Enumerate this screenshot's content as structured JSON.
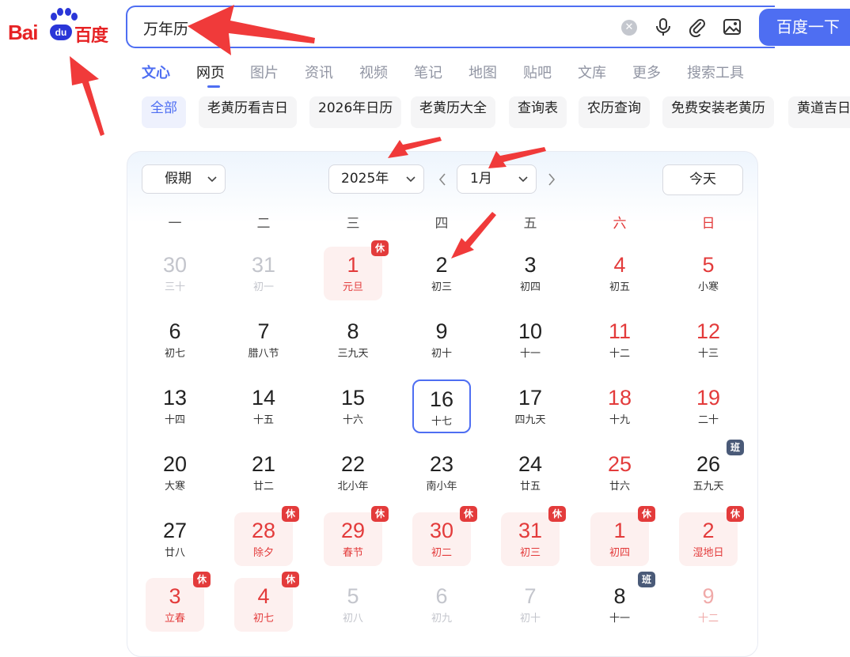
{
  "logo": {
    "left": "Bai",
    "mid": "du",
    "right": "百度"
  },
  "search": {
    "query": "万年历",
    "button": "百度一下"
  },
  "icons": {
    "clear": "clear-icon",
    "voice": "microphone-icon",
    "attach": "paperclip-icon",
    "image": "image-search-icon"
  },
  "tabs": [
    "文心",
    "网页",
    "图片",
    "资讯",
    "视频",
    "笔记",
    "地图",
    "贴吧",
    "文库",
    "更多",
    "搜索工具"
  ],
  "chips": [
    "全部",
    "老黄历看吉日",
    "2026年日历",
    "老黄历大全",
    "查询表",
    "农历查询",
    "免费安装老黄历",
    "黄道吉日"
  ],
  "calendar": {
    "holiday_select": "假期",
    "year_select": "2025年",
    "month_select": "1月",
    "today_button": "今天",
    "weekdays": [
      "一",
      "二",
      "三",
      "四",
      "五",
      "六",
      "日"
    ],
    "rows": [
      [
        {
          "d": "30",
          "l": "三十",
          "s": "gray"
        },
        {
          "d": "31",
          "l": "初一",
          "s": "gray"
        },
        {
          "d": "1",
          "l": "元旦",
          "s": "red hol",
          "b": "休"
        },
        {
          "d": "2",
          "l": "初三"
        },
        {
          "d": "3",
          "l": "初四"
        },
        {
          "d": "4",
          "l": "初五",
          "s": "redn"
        },
        {
          "d": "5",
          "l": "小寒",
          "s": "redn"
        }
      ],
      [
        {
          "d": "6",
          "l": "初七"
        },
        {
          "d": "7",
          "l": "腊八节"
        },
        {
          "d": "8",
          "l": "三九天"
        },
        {
          "d": "9",
          "l": "初十"
        },
        {
          "d": "10",
          "l": "十一"
        },
        {
          "d": "11",
          "l": "十二",
          "s": "redn"
        },
        {
          "d": "12",
          "l": "十三",
          "s": "redn"
        }
      ],
      [
        {
          "d": "13",
          "l": "十四"
        },
        {
          "d": "14",
          "l": "十五"
        },
        {
          "d": "15",
          "l": "十六"
        },
        {
          "d": "16",
          "l": "十七",
          "s": "today"
        },
        {
          "d": "17",
          "l": "四九天"
        },
        {
          "d": "18",
          "l": "十九",
          "s": "redn"
        },
        {
          "d": "19",
          "l": "二十",
          "s": "redn"
        }
      ],
      [
        {
          "d": "20",
          "l": "大寒"
        },
        {
          "d": "21",
          "l": "廿二"
        },
        {
          "d": "22",
          "l": "北小年"
        },
        {
          "d": "23",
          "l": "南小年"
        },
        {
          "d": "24",
          "l": "廿五"
        },
        {
          "d": "25",
          "l": "廿六",
          "s": "redn"
        },
        {
          "d": "26",
          "l": "五九天",
          "b": "班"
        }
      ],
      [
        {
          "d": "27",
          "l": "廿八"
        },
        {
          "d": "28",
          "l": "除夕",
          "s": "red hol",
          "b": "休"
        },
        {
          "d": "29",
          "l": "春节",
          "s": "red hol",
          "b": "休"
        },
        {
          "d": "30",
          "l": "初二",
          "s": "red hol",
          "b": "休"
        },
        {
          "d": "31",
          "l": "初三",
          "s": "red hol",
          "b": "休"
        },
        {
          "d": "1",
          "l": "初四",
          "s": "red hol",
          "b": "休"
        },
        {
          "d": "2",
          "l": "湿地日",
          "s": "red hol",
          "b": "休"
        }
      ],
      [
        {
          "d": "3",
          "l": "立春",
          "s": "red hol",
          "b": "休"
        },
        {
          "d": "4",
          "l": "初七",
          "s": "red hol",
          "b": "休"
        },
        {
          "d": "5",
          "l": "初八",
          "s": "gray"
        },
        {
          "d": "6",
          "l": "初九",
          "s": "gray"
        },
        {
          "d": "7",
          "l": "初十",
          "s": "gray"
        },
        {
          "d": "8",
          "l": "十一",
          "b": "班"
        },
        {
          "d": "9",
          "l": "十二",
          "s": "redfade"
        }
      ]
    ]
  },
  "colors": {
    "accent": "#4e6ef2",
    "holiday_red": "#e33b3b",
    "annotation_arrow": "#f03a3a"
  }
}
